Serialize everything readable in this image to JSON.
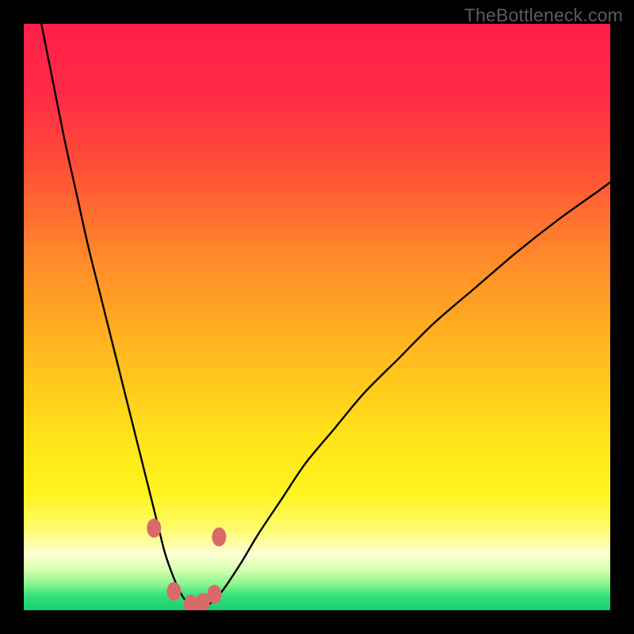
{
  "watermark": "TheBottleneck.com",
  "gradient_stops": [
    {
      "offset": 0.0,
      "color": "#ff1f4a"
    },
    {
      "offset": 0.12,
      "color": "#ff2b46"
    },
    {
      "offset": 0.25,
      "color": "#ff5136"
    },
    {
      "offset": 0.4,
      "color": "#ff8a2a"
    },
    {
      "offset": 0.55,
      "color": "#ffb61f"
    },
    {
      "offset": 0.7,
      "color": "#ffe21a"
    },
    {
      "offset": 0.8,
      "color": "#fff41f"
    },
    {
      "offset": 0.86,
      "color": "#fffb6a"
    },
    {
      "offset": 0.905,
      "color": "#fcffd4"
    },
    {
      "offset": 0.93,
      "color": "#d7ffb0"
    },
    {
      "offset": 0.955,
      "color": "#8cf58e"
    },
    {
      "offset": 0.975,
      "color": "#35e07a"
    },
    {
      "offset": 1.0,
      "color": "#18cf70"
    }
  ],
  "chart_data": {
    "type": "line",
    "title": "",
    "xlabel": "",
    "ylabel": "",
    "xlim": [
      0,
      100
    ],
    "ylim": [
      0,
      100
    ],
    "curve_color": "#000000",
    "marker_color": "#d96a6a",
    "series": [
      {
        "name": "bottleneck-curve",
        "x": [
          3,
          5,
          7,
          9,
          11,
          13,
          15,
          17,
          19,
          20,
          21,
          22,
          23,
          24,
          25,
          26,
          27,
          28,
          29,
          30,
          32,
          34,
          37,
          40,
          44,
          48,
          53,
          58,
          64,
          70,
          77,
          84,
          91,
          98,
          100
        ],
        "y": [
          100,
          90,
          80,
          71,
          62,
          54,
          46,
          38,
          30,
          26,
          22,
          18,
          14,
          10,
          7,
          4.5,
          2.5,
          1.2,
          0.5,
          0.5,
          1.3,
          3.5,
          8,
          13,
          19,
          25,
          31,
          37,
          43,
          49,
          55,
          61,
          66.5,
          71.5,
          73
        ]
      }
    ],
    "markers": [
      {
        "x": 22.2,
        "y": 14
      },
      {
        "x": 25.6,
        "y": 3.2
      },
      {
        "x": 28.5,
        "y": 1
      },
      {
        "x": 30.5,
        "y": 1.3
      },
      {
        "x": 32.5,
        "y": 2.7
      },
      {
        "x": 33.3,
        "y": 12.5
      }
    ]
  }
}
